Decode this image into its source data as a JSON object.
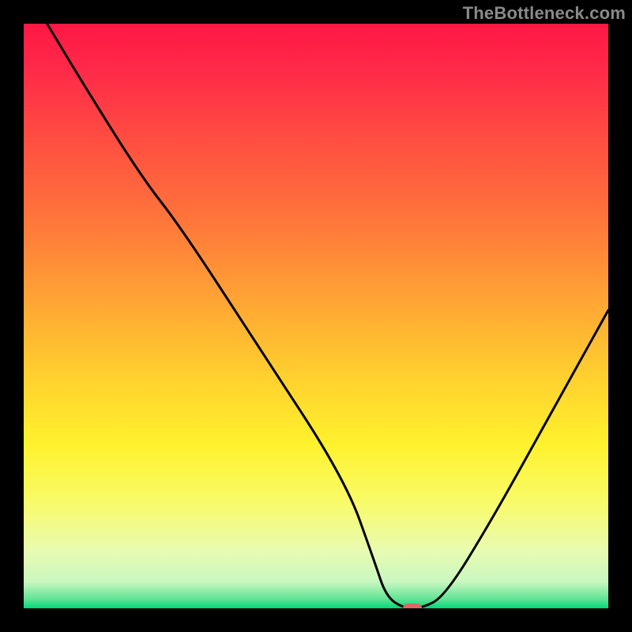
{
  "watermark": "TheBottleneck.com",
  "chart_data": {
    "type": "line",
    "title": "",
    "xlabel": "",
    "ylabel": "",
    "xlim": [
      0,
      100
    ],
    "ylim": [
      0,
      100
    ],
    "x": [
      4,
      10,
      20,
      27,
      40,
      55,
      60,
      62,
      65,
      68,
      72,
      80,
      90,
      100
    ],
    "values": [
      100,
      90,
      74,
      65,
      45,
      22,
      8,
      2,
      0,
      0,
      2,
      15,
      33,
      51
    ],
    "marker": {
      "x": 66.5,
      "y": 0,
      "color": "#e06666"
    },
    "gradient_stops": [
      {
        "offset": 0.0,
        "color": "#ff1744"
      },
      {
        "offset": 0.08,
        "color": "#ff2a49"
      },
      {
        "offset": 0.2,
        "color": "#ff4e41"
      },
      {
        "offset": 0.35,
        "color": "#ff7a3a"
      },
      {
        "offset": 0.5,
        "color": "#ffae33"
      },
      {
        "offset": 0.62,
        "color": "#ffd52e"
      },
      {
        "offset": 0.72,
        "color": "#fff22d"
      },
      {
        "offset": 0.82,
        "color": "#f8fb6a"
      },
      {
        "offset": 0.9,
        "color": "#e9fbb0"
      },
      {
        "offset": 0.955,
        "color": "#c9f7c0"
      },
      {
        "offset": 0.985,
        "color": "#5de394"
      },
      {
        "offset": 1.0,
        "color": "#00d977"
      }
    ]
  }
}
